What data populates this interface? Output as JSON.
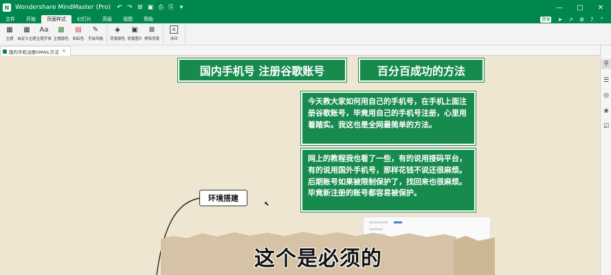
{
  "window": {
    "title": "Wondershare MindMaster (Pro)",
    "logo": "N",
    "controls": [
      "—",
      "□",
      "✕"
    ]
  },
  "quick_access": [
    "↶",
    "↷",
    "⊞",
    "▣",
    "⎙",
    "⎘",
    "▾"
  ],
  "menu": {
    "tabs": [
      "文件",
      "开始",
      "页面样式",
      "幻灯片",
      "高级",
      "视图",
      "帮助"
    ],
    "active_tab": "页面样式",
    "right": {
      "login": "登录"
    }
  },
  "ribbon": {
    "groups": [
      [
        {
          "label": "主题",
          "icon": "grid-icon"
        },
        {
          "label": "自定义主题",
          "icon": "grid-icon"
        },
        {
          "label": "主题字体",
          "icon": "font-icon"
        },
        {
          "label": "主题颜色",
          "icon": "palette-icon"
        },
        {
          "label": "彩虹色",
          "icon": "rainbow-icon"
        },
        {
          "label": "手绘风格",
          "icon": "pen-icon"
        }
      ],
      [
        {
          "label": "背景颜色",
          "icon": "paint-bucket-icon"
        },
        {
          "label": "背景图片",
          "icon": "image-icon"
        },
        {
          "label": "移除背景",
          "icon": "remove-background-icon"
        }
      ],
      [
        {
          "label": "水印",
          "icon": "watermark-icon"
        }
      ]
    ]
  },
  "doc_tab": {
    "title": "国内手机注册GMAIL方法",
    "close": "×"
  },
  "canvas": {
    "topic_left": "国内手机号 注册谷歌账号",
    "topic_right": "百分百成功的方法",
    "para1": "今天教大家如何用自己的手机号，在手机上面注册谷歌账号，毕竟用自己的手机号注册，心里用着踏实。我这也是全网最简单的方法。",
    "para2": "网上的教程我也看了一些，有的说用接码平台，有的说用国外手机号，那样花钱不说还很麻烦。后期账号如果被限制保护了，找回来也很麻烦。毕竟新注册的账号都容易被保护。",
    "node_label": "环境搭建",
    "big_text": "这个是必须的"
  },
  "colors": {
    "brand": "#00874d",
    "topic_fill": "#178a4d",
    "canvas_bg": "#efe6d2"
  }
}
